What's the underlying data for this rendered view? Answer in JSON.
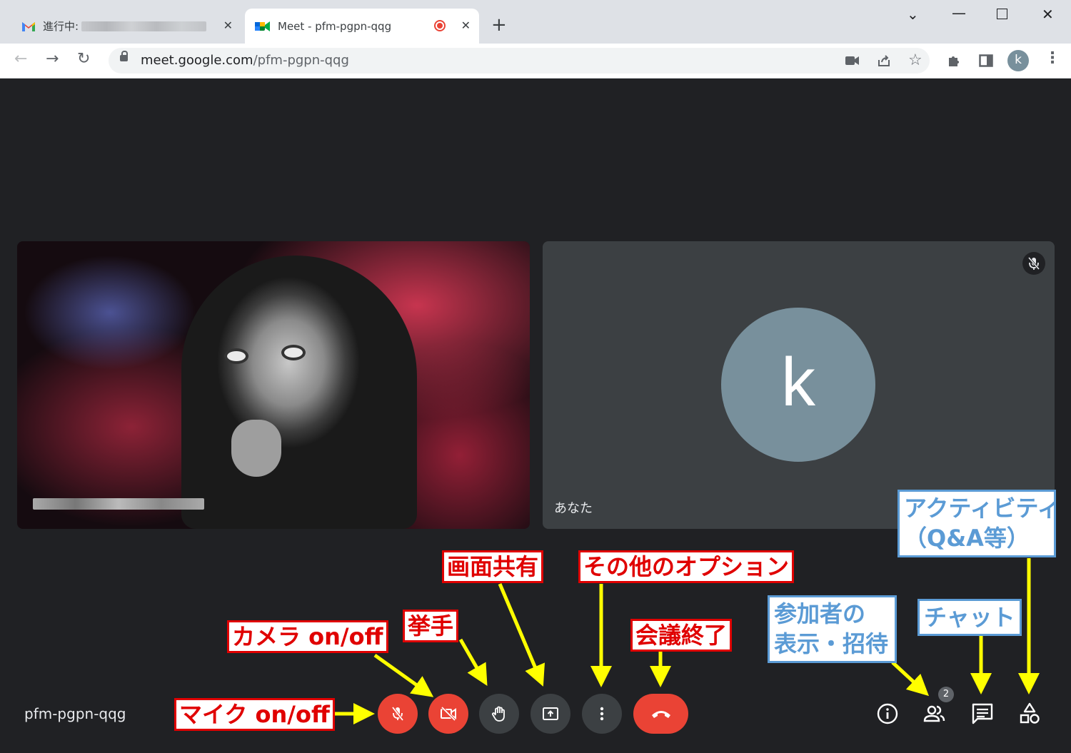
{
  "browser": {
    "tabs": [
      {
        "title_prefix": "進行中:",
        "favicon": "gmail-icon"
      },
      {
        "title": "Meet - pfm-pgpn-qqg",
        "favicon": "meet-icon",
        "recording": true
      }
    ],
    "url_host": "meet.google.com",
    "url_path": "/pfm-pgpn-qqg",
    "profile_initial": "k"
  },
  "meet": {
    "meeting_code": "pfm-pgpn-qqg",
    "self_label": "あなた",
    "self_initial": "k",
    "participant_count": "2",
    "colors": {
      "danger": "#ea4335",
      "control": "#3c4043",
      "background": "#202124"
    }
  },
  "annotations": {
    "mic": "マイク on/off",
    "camera": "カメラ on/off",
    "raise_hand": "挙手",
    "share_screen": "画面共有",
    "more_options": "その他のオプション",
    "end_call": "会議終了",
    "people_line1": "参加者の",
    "people_line2": "表示・招待",
    "chat": "チャット",
    "activities_line1": "アクティビティ",
    "activities_line2": "（Q&A等）"
  }
}
